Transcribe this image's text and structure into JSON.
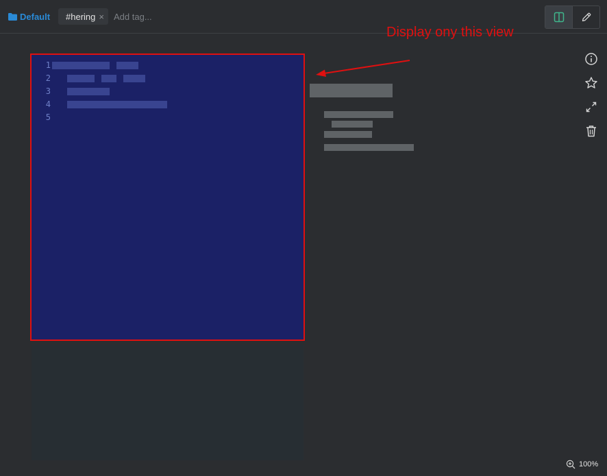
{
  "header": {
    "folder_label": "Default",
    "tag_label": "#hering",
    "tag_close_glyph": "×",
    "add_tag_placeholder": "Add tag..."
  },
  "view_toggle": {
    "active_view": "split-view",
    "accent_color": "#3fb68b",
    "buttons": [
      {
        "icon": "split-view-icon"
      },
      {
        "icon": "pencil-icon"
      }
    ]
  },
  "sidebar_actions": [
    {
      "icon": "info-icon"
    },
    {
      "icon": "star-icon"
    },
    {
      "icon": "expand-icon"
    },
    {
      "icon": "trash-icon"
    }
  ],
  "editor": {
    "background_color": "#1b2166",
    "line_numbers": [
      "1",
      "2",
      "3",
      "4",
      "5"
    ]
  },
  "annotation": {
    "text": "Display ony this view",
    "color": "#e01010"
  },
  "status": {
    "zoom_label": "100%"
  }
}
